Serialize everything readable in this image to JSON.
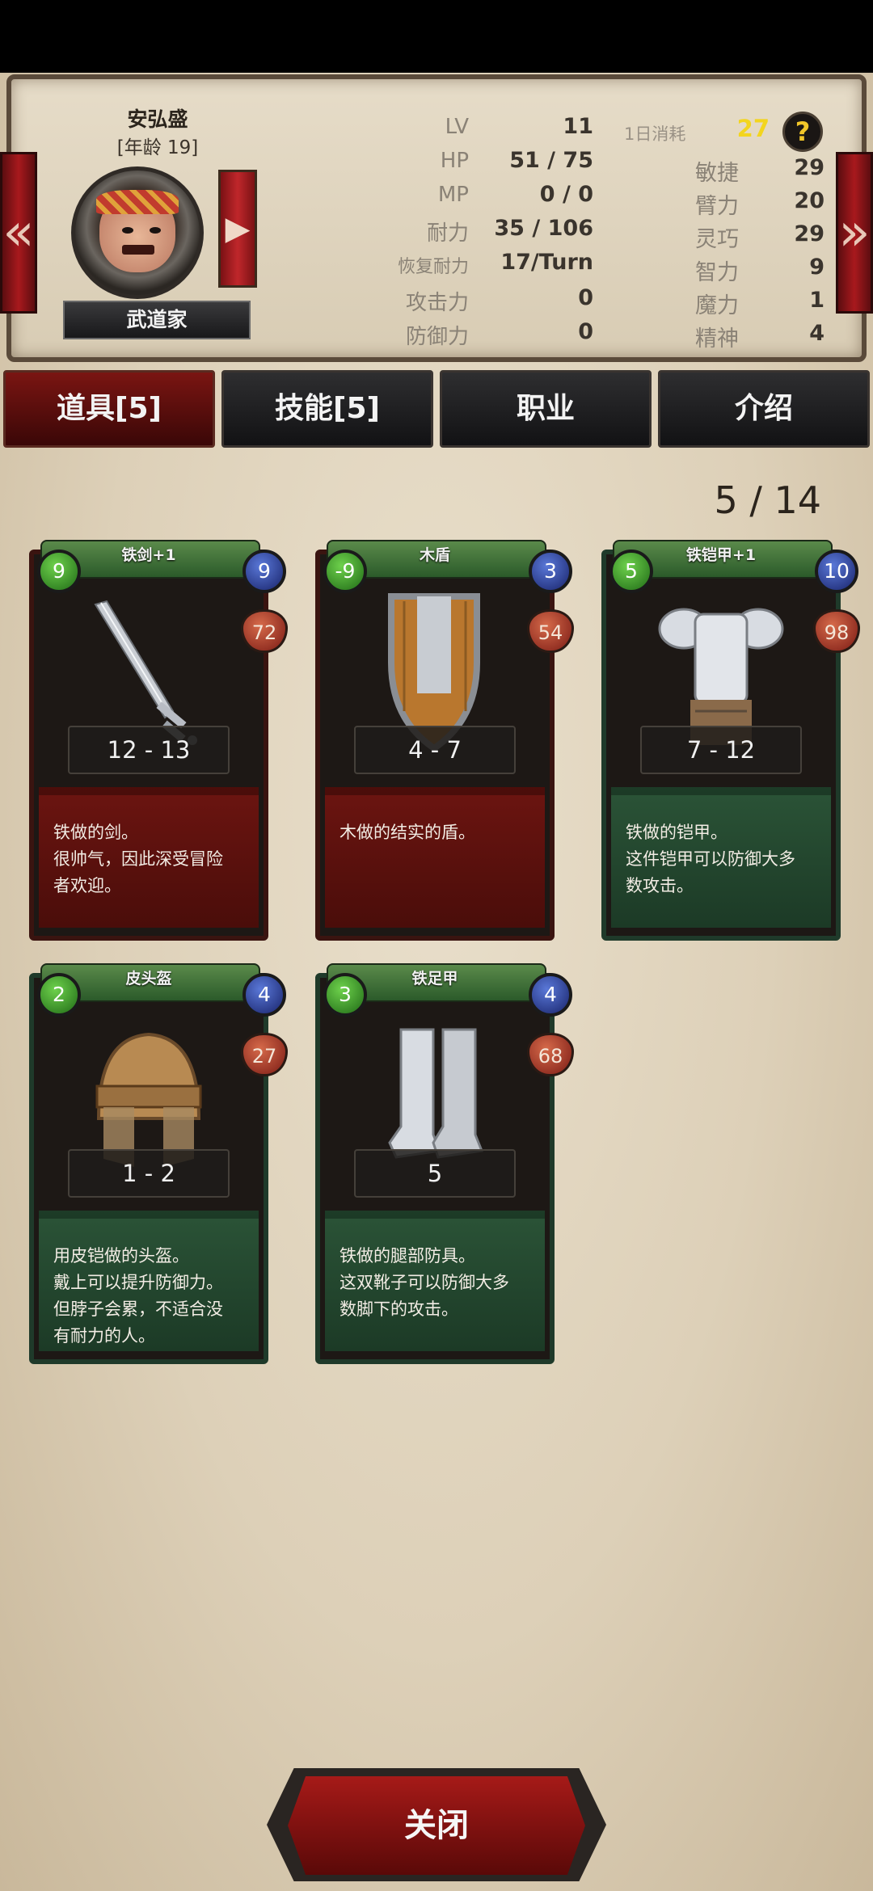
{
  "character": {
    "name": "安弘盛",
    "age": "[年龄 19]",
    "class_name": "武道家"
  },
  "stats": [
    {
      "label": "LV",
      "value": "11"
    },
    {
      "label": "HP",
      "value": "51 / 75"
    },
    {
      "label": "MP",
      "value": "0 / 0"
    },
    {
      "label": "耐力",
      "value": "35 / 106"
    },
    {
      "label": "恢复耐力",
      "value": "17/Turn"
    },
    {
      "label": "攻击力",
      "value": "0"
    },
    {
      "label": "防御力",
      "value": "0"
    }
  ],
  "daily": {
    "label": "1日消耗",
    "value": "27",
    "help": "?"
  },
  "attributes": [
    {
      "label": "敏捷",
      "value": "29"
    },
    {
      "label": "臂力",
      "value": "20"
    },
    {
      "label": "灵巧",
      "value": "29"
    },
    {
      "label": "智力",
      "value": "9"
    },
    {
      "label": "魔力",
      "value": "1"
    },
    {
      "label": "精神",
      "value": "4"
    }
  ],
  "tabs": [
    {
      "label": "道具[5]",
      "active": true
    },
    {
      "label": "技能[5]",
      "active": false
    },
    {
      "label": "职业",
      "active": false
    },
    {
      "label": "介绍",
      "active": false
    }
  ],
  "inventory_count": "5 / 14",
  "items": [
    {
      "name": "铁剑+1",
      "left_orb": "9",
      "right_orb": "9",
      "durability": "72",
      "range": "12 - 13",
      "theme": "red",
      "desc": [
        "铁做的剑。",
        "很帅气，因此深受冒险",
        "者欢迎。"
      ],
      "icon": "sword-icon"
    },
    {
      "name": "木盾",
      "left_orb": "-9",
      "right_orb": "3",
      "durability": "54",
      "range": "4 - 7",
      "theme": "red",
      "desc": [
        "木做的结实的盾。"
      ],
      "icon": "shield-icon"
    },
    {
      "name": "铁铠甲+1",
      "left_orb": "5",
      "right_orb": "10",
      "durability": "98",
      "range": "7 - 12",
      "theme": "green",
      "desc": [
        "铁做的铠甲。",
        "这件铠甲可以防御大多",
        "数攻击。"
      ],
      "icon": "armor-icon"
    },
    {
      "name": "皮头盔",
      "left_orb": "2",
      "right_orb": "4",
      "durability": "27",
      "range": "1 - 2",
      "theme": "green",
      "desc": [
        "用皮铠做的头盔。",
        "戴上可以提升防御力。",
        "但脖子会累，不适合没",
        "有耐力的人。"
      ],
      "icon": "helmet-icon"
    },
    {
      "name": "铁足甲",
      "left_orb": "3",
      "right_orb": "4",
      "durability": "68",
      "range": "5",
      "theme": "green",
      "desc": [
        "铁做的腿部防具。",
        "这双靴子可以防御大多",
        "数脚下的攻击。"
      ],
      "icon": "boots-icon"
    }
  ],
  "close_label": "关闭"
}
